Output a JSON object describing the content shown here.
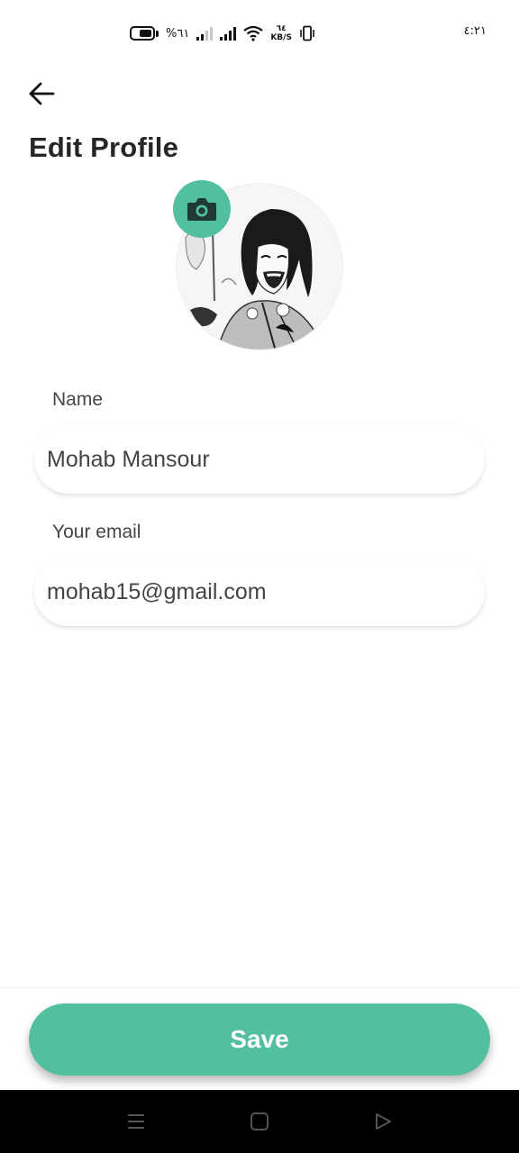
{
  "status_bar": {
    "battery_percent": "%٦١",
    "network_speed_value": "٦٤",
    "network_speed_unit": "KB/S",
    "time": "٤:٢١"
  },
  "header": {
    "back_icon": "arrow-left-icon",
    "title": "Edit Profile"
  },
  "avatar": {
    "camera_icon": "camera-icon"
  },
  "form": {
    "name": {
      "label": "Name",
      "value": "Mohab Mansour"
    },
    "email": {
      "label": "Your email",
      "value": "mohab15@gmail.com"
    }
  },
  "actions": {
    "save_label": "Save"
  },
  "navigation": {
    "menu_icon": "menu-icon",
    "home_icon": "home-square-icon",
    "back_icon": "back-triangle-icon"
  },
  "colors": {
    "accent": "#52bf9e",
    "text": "#262626",
    "nav_bar": "#000000"
  }
}
